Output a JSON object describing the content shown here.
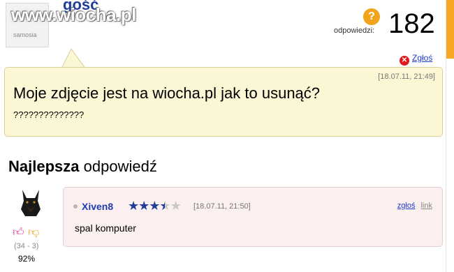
{
  "watermark": "www.wiocha.pl",
  "question": {
    "author": "gość",
    "avatar_label": "samosia",
    "answers_label": "odpowiedzi:",
    "answers_count": "182",
    "report_label": "Zgłoś",
    "date": "[18.07.11, 21:49]",
    "title": "Moje zdjęcie jest na wiocha.pl jak to usunąć?",
    "body": "??????????????"
  },
  "best_answer": {
    "heading_bold": "Najlepsza",
    "heading_rest": "odpowiedź",
    "author": "Xiven8",
    "rating": 3.5,
    "date": "[18.07.11, 21:50]",
    "report_label": "zgłoś",
    "link_label": "link",
    "text": "spal komputer",
    "votes": "(34 - 3)",
    "percent": "92%"
  },
  "colors": {
    "accent_orange": "#f5a623",
    "bubble_bg": "#fbf6d4",
    "answer_bg": "#fbefef",
    "link_blue": "#1f3dcc"
  },
  "icons": {
    "question": "question-mark-icon",
    "report": "close-circle-icon",
    "thumb_up": "thumb-up-icon",
    "thumb_down": "thumb-down-icon"
  }
}
